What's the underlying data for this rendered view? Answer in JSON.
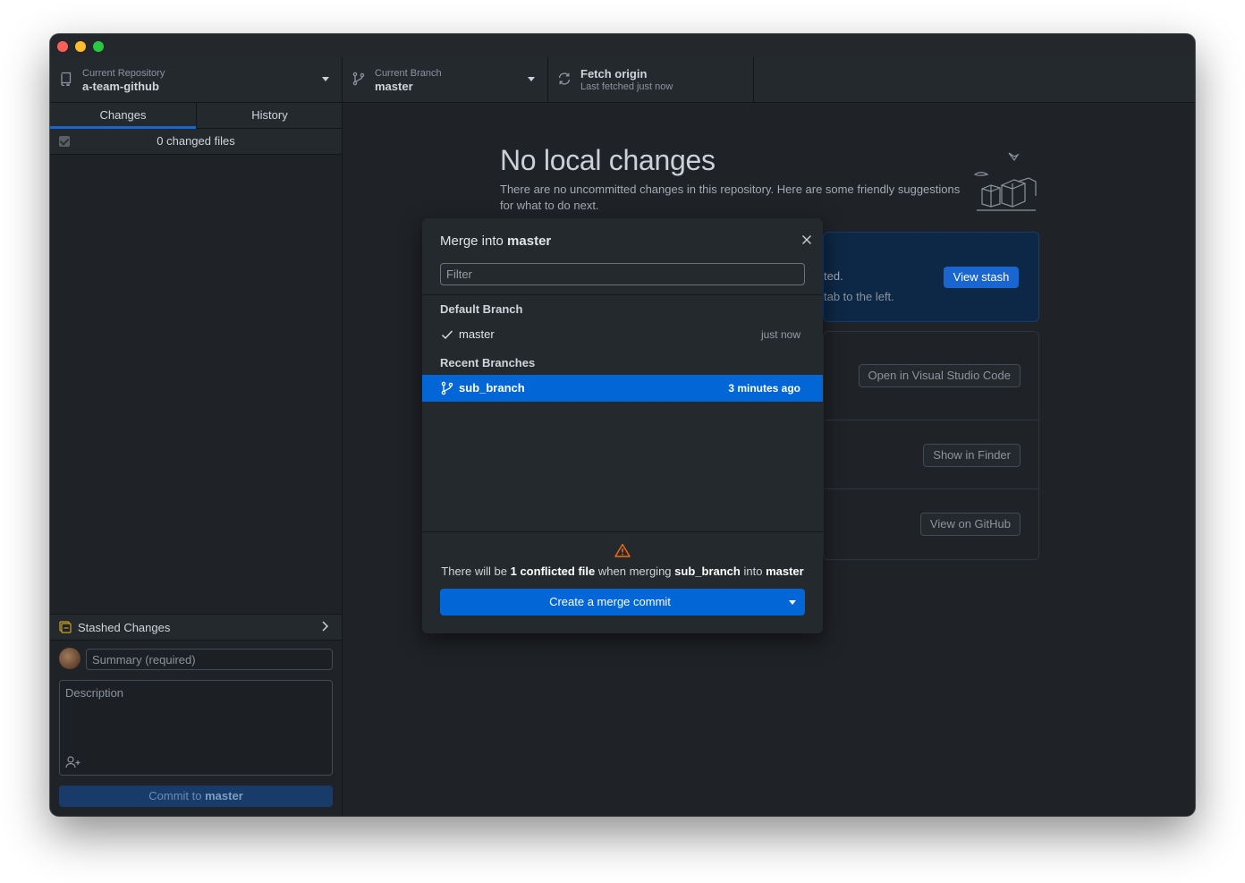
{
  "toolbar": {
    "repo_label": "Current Repository",
    "repo_name": "a-team-github",
    "branch_label": "Current Branch",
    "branch_name": "master",
    "fetch_title": "Fetch origin",
    "fetch_subtitle": "Last fetched just now"
  },
  "sidebar": {
    "tabs": [
      {
        "label": "Changes",
        "active": true
      },
      {
        "label": "History",
        "active": false
      }
    ],
    "changed_files": "0 changed files",
    "stashed_label": "Stashed Changes",
    "summary_placeholder": "Summary (required)",
    "description_placeholder": "Description",
    "commit_prefix": "Commit to",
    "commit_branch": "master"
  },
  "main": {
    "title": "No local changes",
    "description": "There are no uncommitted changes in this repository. Here are some friendly suggestions for what to do next.",
    "stash_text_1": "ted.",
    "stash_text_2": "tab to the left.",
    "view_stash": "View stash",
    "actions": [
      "Open in Visual Studio Code",
      "Show in Finder",
      "View on GitHub"
    ]
  },
  "modal": {
    "title_prefix": "Merge into",
    "title_branch": "master",
    "filter_placeholder": "Filter",
    "default_group": "Default Branch",
    "default_branch": {
      "name": "master",
      "time": "just now",
      "icon": "check-icon"
    },
    "recent_group": "Recent Branches",
    "recent_branches": [
      {
        "name": "sub_branch",
        "time": "3 minutes ago",
        "icon": "branch-icon",
        "selected": true
      }
    ],
    "msg_1": "There will be",
    "msg_count": "1 conflicted file",
    "msg_2": "when merging",
    "msg_source": "sub_branch",
    "msg_3": "into",
    "msg_target": "master",
    "merge_button": "Create a merge commit"
  },
  "colors": {
    "accent": "#0366d6",
    "warning": "#f66a0a",
    "background": "#1f2227"
  }
}
